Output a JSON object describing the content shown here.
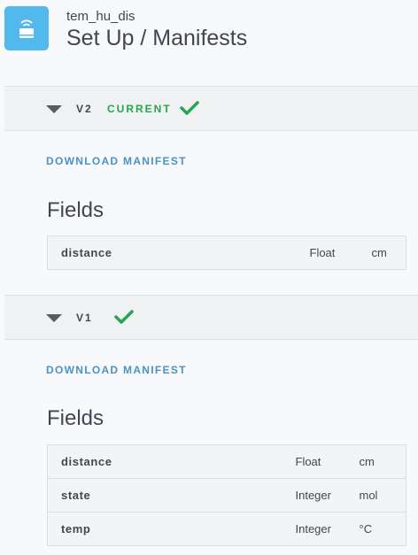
{
  "header": {
    "device_name": "tem_hu_dis",
    "page_title": "Set Up / Manifests",
    "accent_color": "#53b8ec"
  },
  "versions": [
    {
      "label": "V2",
      "status_label": "CURRENT",
      "status_color": "#27a551",
      "download_label": "DOWNLOAD MANIFEST",
      "fields_heading": "Fields",
      "fields": [
        {
          "name": "distance",
          "type": "Float",
          "unit": "cm"
        }
      ]
    },
    {
      "label": "V1",
      "download_label": "DOWNLOAD MANIFEST",
      "fields_heading": "Fields",
      "fields": [
        {
          "name": "distance",
          "type": "Float",
          "unit": "cm"
        },
        {
          "name": "state",
          "type": "Integer",
          "unit": "mol"
        },
        {
          "name": "temp",
          "type": "Integer",
          "unit": "°C"
        }
      ]
    }
  ],
  "icons": {
    "app": "wifi-device-icon",
    "expand": "triangle-down-icon",
    "check": "checkmark-icon"
  }
}
